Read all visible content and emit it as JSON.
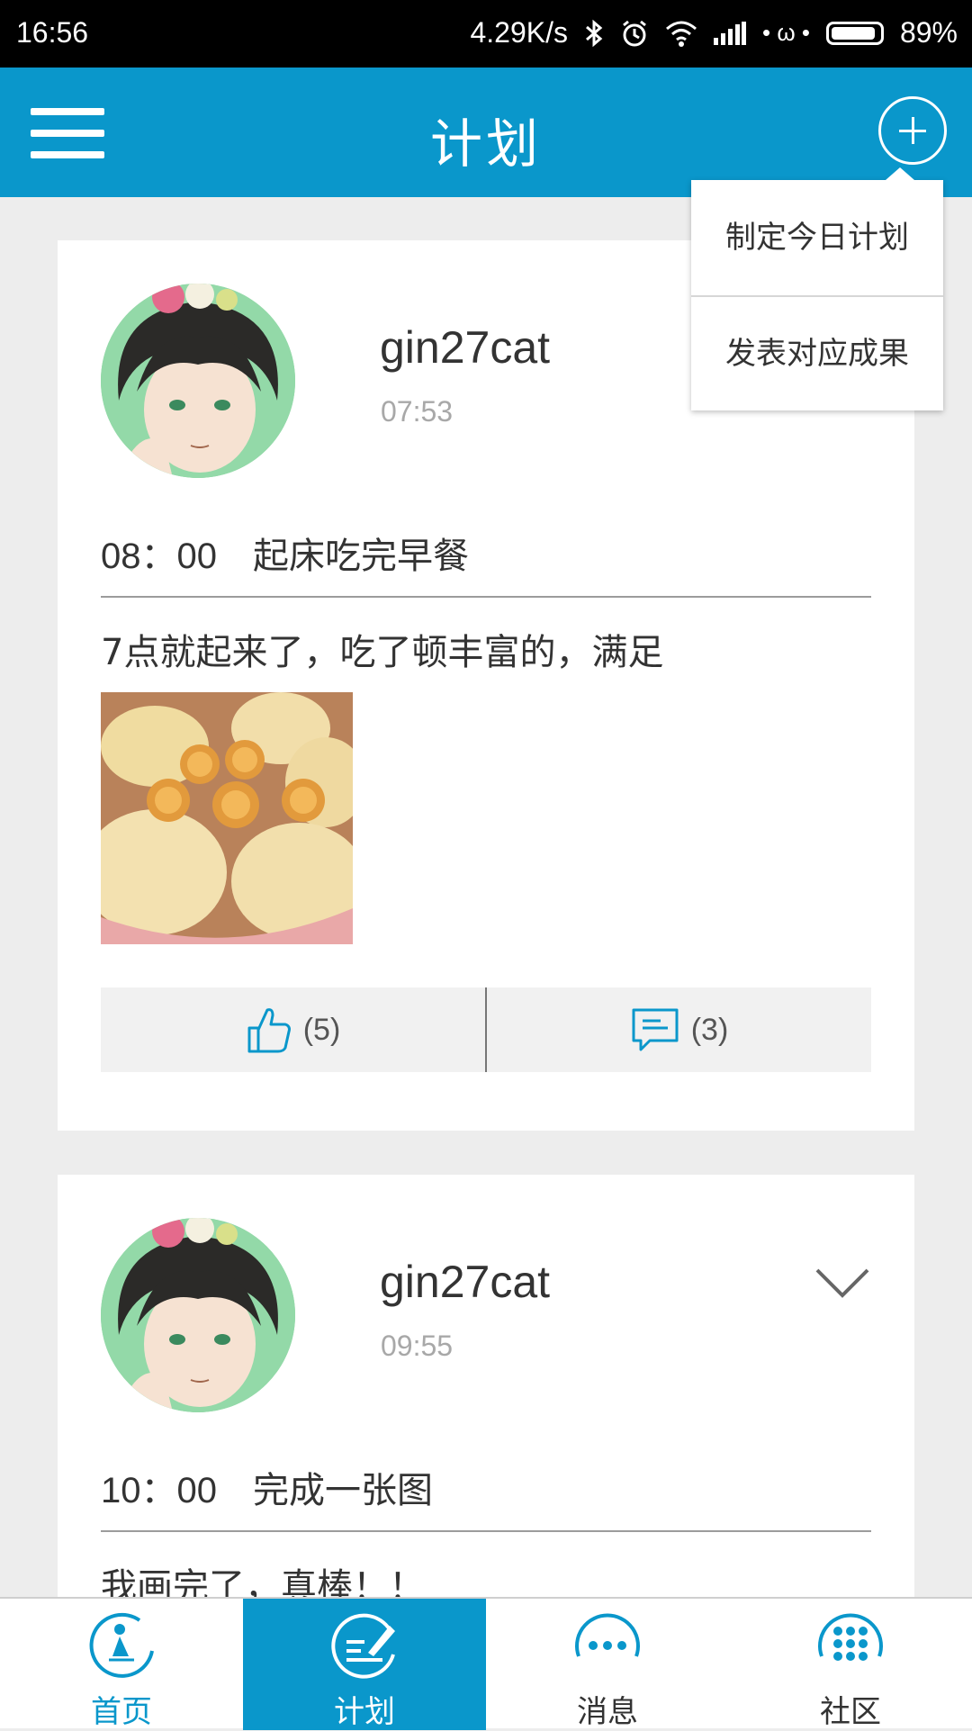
{
  "status_bar": {
    "time": "16:56",
    "net_speed": "4.29K/s",
    "carrier_glyph": "• ω •",
    "battery": "89%"
  },
  "header": {
    "title": "计划"
  },
  "menu": {
    "items": [
      "制定今日计划",
      "发表对应成果"
    ]
  },
  "posts": [
    {
      "username": "gin27cat",
      "time": "07:53",
      "plan_time": "08：00",
      "plan_text": "起床吃完早餐",
      "content": "7点就起来了，吃了顿丰富的，满足",
      "likes": "(5)",
      "comments": "(3)"
    },
    {
      "username": "gin27cat",
      "time": "09:55",
      "plan_time": "10：00",
      "plan_text": "完成一张图",
      "content": "我画完了，真棒！！"
    }
  ],
  "bottom_nav": {
    "items": [
      {
        "label": "首页",
        "icon": "home-icon"
      },
      {
        "label": "计划",
        "icon": "plan-icon"
      },
      {
        "label": "消息",
        "icon": "message-icon"
      },
      {
        "label": "社区",
        "icon": "community-icon"
      }
    ],
    "active": "计划"
  },
  "colors": {
    "accent": "#0a97cb",
    "background": "#ededed"
  }
}
